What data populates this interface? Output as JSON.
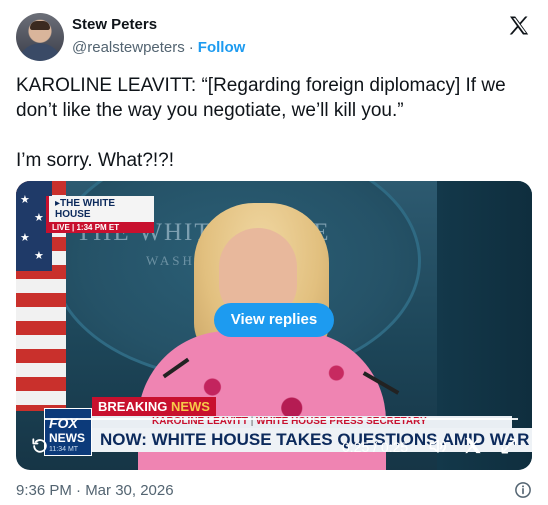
{
  "author": {
    "name": "Stew Peters",
    "handle": "@realstewpeters",
    "separator": "·",
    "follow_label": "Follow"
  },
  "tweet": {
    "text": "KAROLINE LEAVITT: “[Regarding foreign diplomacy] If we don’t like the way you negotiate, we’ll kill you.”\n\nI’m sorry. What?!?!"
  },
  "video": {
    "live_bug_title": "▸THE WHITE HOUSE",
    "live_bug_sub": "LIVE | 1:34 PM ET",
    "backdrop_line1": "THE WHITE HOUSE",
    "backdrop_line2": "WASHINGTON",
    "view_replies_label": "View replies",
    "breaking_label": "BREAKING",
    "breaking_news": "NEWS",
    "name_strip_name": "KAROLINE LEAVITT",
    "name_strip_sep": " | ",
    "name_strip_title": "WHITE HOUSE PRESS SECRETARY",
    "headline": "NOW: WHITE HOUSE TAKES QUESTIONS AMID WAR IN IRAN",
    "fox_word": "FOX",
    "fox_news": "NEWS",
    "fox_time": "11:34 MT",
    "time_display": "0:25 / 0:25",
    "progress_fraction": 1.0
  },
  "footer": {
    "timestamp": "9:36 PM · Mar 30, 2026"
  },
  "colors": {
    "accent": "#1d9bf0",
    "fox_red": "#c8102e",
    "fox_navy": "#0c2a5c"
  },
  "icons": [
    "x-logo-icon",
    "replay-icon",
    "volume-icon",
    "x-overlay-icon",
    "fullscreen-icon",
    "info-icon"
  ]
}
